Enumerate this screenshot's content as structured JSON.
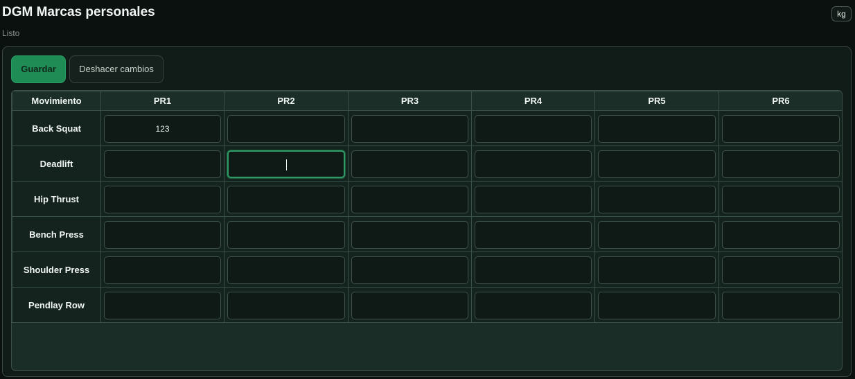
{
  "app": {
    "title": "DGM Marcas personales",
    "status": "Listo",
    "unit": "kg"
  },
  "toolbar": {
    "save_label": "Guardar",
    "undo_label": "Deshacer cambios"
  },
  "table": {
    "headers": [
      "Movimiento",
      "PR1",
      "PR2",
      "PR3",
      "PR4",
      "PR5",
      "PR6"
    ],
    "rows": [
      {
        "movement": "Back Squat",
        "values": [
          "123",
          "",
          "",
          "",
          "",
          ""
        ]
      },
      {
        "movement": "Deadlift",
        "values": [
          "",
          "",
          "",
          "",
          "",
          ""
        ]
      },
      {
        "movement": "Hip Thrust",
        "values": [
          "",
          "",
          "",
          "",
          "",
          ""
        ]
      },
      {
        "movement": "Bench Press",
        "values": [
          "",
          "",
          "",
          "",
          "",
          ""
        ]
      },
      {
        "movement": "Shoulder Press",
        "values": [
          "",
          "",
          "",
          "",
          "",
          ""
        ]
      },
      {
        "movement": "Pendlay Row",
        "values": [
          "",
          "",
          "",
          "",
          "",
          ""
        ]
      }
    ],
    "focused_row": 1,
    "focused_col": 1
  },
  "colors": {
    "accent": "#1f8c55",
    "background": "#0b110e",
    "panel": "#111b17"
  }
}
